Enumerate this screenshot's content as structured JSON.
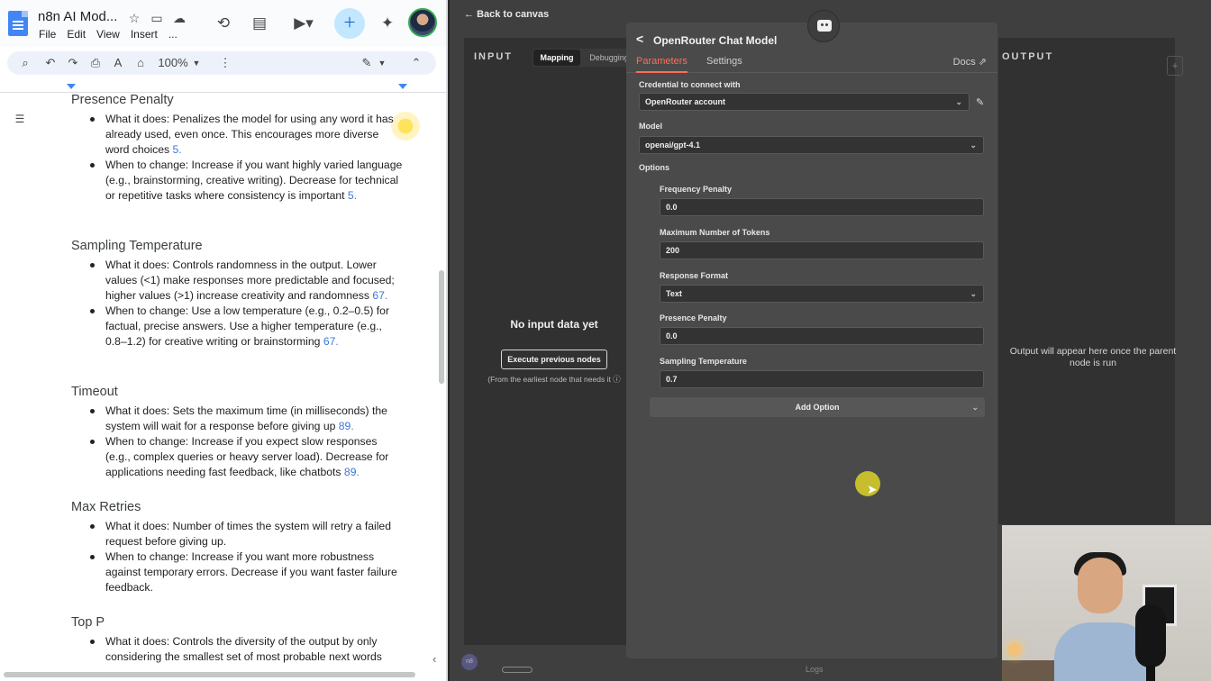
{
  "docs": {
    "title": "n8n AI Mod...",
    "menu": [
      "File",
      "Edit",
      "View",
      "Insert",
      "..."
    ],
    "zoom": "100%",
    "sections": [
      {
        "heading": "Presence Penalty",
        "bullets": [
          {
            "text": "What it does: Penalizes the model for using any word it has already used, even once. This encourages more diverse word choices ",
            "cite": "5."
          },
          {
            "text": "When to change: Increase if you want highly varied language (e.g., brainstorming, creative writing). Decrease for technical or repetitive tasks where consistency is important ",
            "cite": "5."
          }
        ]
      },
      {
        "heading": "Sampling Temperature",
        "bullets": [
          {
            "text": "What it does: Controls randomness in the output. Lower values (<1) make responses more predictable and focused; higher values (>1) increase creativity and randomness ",
            "cite": "67."
          },
          {
            "text": "When to change: Use a low temperature (e.g., 0.2–0.5) for factual, precise answers. Use a higher temperature (e.g., 0.8–1.2) for creative writing or brainstorming ",
            "cite": "67."
          }
        ]
      },
      {
        "heading": "Timeout",
        "bullets": [
          {
            "text": "What it does: Sets the maximum time (in milliseconds) the system will wait for a response before giving up ",
            "cite": "89."
          },
          {
            "text": "When to change: Increase if you expect slow responses (e.g., complex queries or heavy server load). Decrease for applications needing fast feedback, like chatbots ",
            "cite": "89."
          }
        ]
      },
      {
        "heading": "Max Retries",
        "bullets": [
          {
            "text": "What it does: Number of times the system will retry a failed request before giving up.",
            "cite": ""
          },
          {
            "text": "When to change: Increase if you want more robustness against temporary errors. Decrease if you want faster failure feedback.",
            "cite": ""
          }
        ]
      },
      {
        "heading": "Top P",
        "bullets": [
          {
            "text": "What it does: Controls the diversity of the output by only considering the smallest set of most probable next words",
            "cite": ""
          }
        ]
      }
    ]
  },
  "n8n": {
    "back_label": "Back to canvas",
    "input_label": "INPUT",
    "mapping_label": "Mapping",
    "debugging_label": "Debugging",
    "no_input": "No input data yet",
    "execute_label": "Execute previous nodes",
    "execute_note": "(From the earliest node that needs it",
    "output_label": "OUTPUT",
    "output_msg": "Output will appear here once the parent node is run",
    "modal": {
      "title": "OpenRouter Chat Model",
      "tab_parameters": "Parameters",
      "tab_settings": "Settings",
      "docs_label": "Docs",
      "credential_label": "Credential to connect with",
      "credential_value": "OpenRouter account",
      "model_label": "Model",
      "model_value": "openai/gpt-4.1",
      "options_label": "Options",
      "frequency_label": "Frequency Penalty",
      "frequency_value": "0.0",
      "max_tokens_label": "Maximum Number of Tokens",
      "max_tokens_value": "200",
      "response_format_label": "Response Format",
      "response_format_value": "Text",
      "presence_label": "Presence Penalty",
      "presence_value": "0.0",
      "temperature_label": "Sampling Temperature",
      "temperature_value": "0.7",
      "add_option_label": "Add Option"
    },
    "logs_label": "Logs"
  }
}
